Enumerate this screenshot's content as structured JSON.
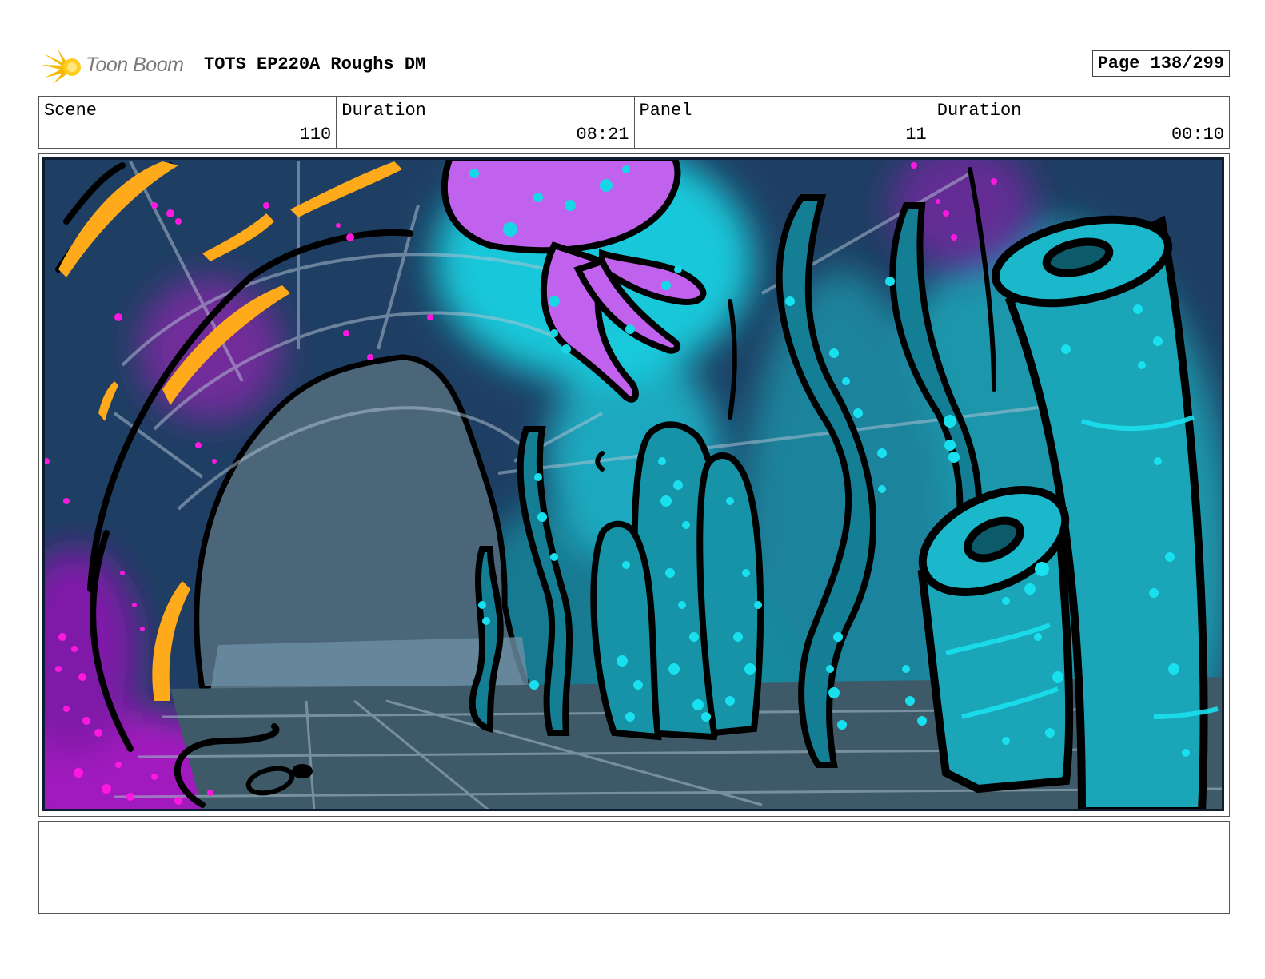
{
  "header": {
    "logo_text": "Toon Boom",
    "title": "TOTS EP220A Roughs DM",
    "page": "Page 138/299"
  },
  "info": {
    "scene_label": "Scene",
    "scene_value": "110",
    "scene_duration_label": "Duration",
    "scene_duration_value": "08:21",
    "panel_label": "Panel",
    "panel_value": "11",
    "panel_duration_label": "Duration",
    "panel_duration_value": "00:10"
  },
  "notes": {
    "text": ""
  },
  "colors": {
    "water_dark": "#1e3f63",
    "glow_cyan": "#19d6e6",
    "coral_teal": "#1596a8",
    "jellyfish": "#c062ee",
    "magenta_spots": "#ff19e0",
    "orange_stroke": "#ffaa1a",
    "cave_interior": "#4a6678",
    "floor": "#3e5a68"
  },
  "icons": {
    "logo": "toon-boom-star-burst-icon"
  }
}
